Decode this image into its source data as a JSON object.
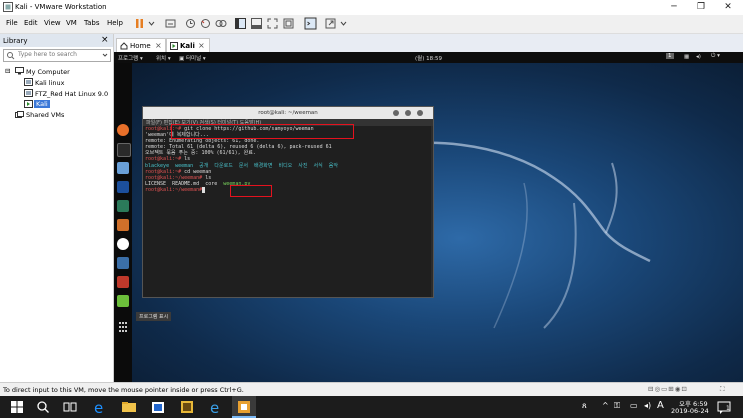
{
  "window": {
    "title": "Kali - VMware Workstation",
    "controls": {
      "minimize": "─",
      "restore": "❐",
      "close": "✕"
    }
  },
  "menubar": {
    "items": [
      "File",
      "Edit",
      "View",
      "VM",
      "Tabs",
      "Help"
    ]
  },
  "library": {
    "header": "Library",
    "close": "×",
    "search_placeholder": "Type here to search",
    "tree": {
      "root": "My Computer",
      "items": [
        "Kali linux",
        "FTZ_Red Hat Linux 9.0",
        "Kali"
      ],
      "shared": "Shared VMs"
    }
  },
  "tabs": [
    {
      "label": "Home"
    },
    {
      "label": "Kali"
    }
  ],
  "guest": {
    "topbar": {
      "left": [
        "프로그램 ▾",
        "위치 ▾",
        "▣ 터미널 ▾"
      ],
      "clock": "(월) 18:59",
      "right": "1"
    },
    "terminal": {
      "title": "root@kali: ~/weeman",
      "menu": "파일(F)  편집(E)  보기(V)  검색(S)  터미널(T)  도움말(H)",
      "lines": [
        {
          "prompt": "root@kali:~#",
          "cmd": " git clone https://github.com/samyoyo/weeman"
        },
        {
          "text": "'weeman'에 복제합니다..."
        },
        {
          "text": "remote: Enumerating objects: 61, done."
        },
        {
          "text": "remote: Total 61 (delta 6), reused 6 (delta 6), pack-reused 61"
        },
        {
          "text": "오브젝트 묶음 푸는 중: 100% (61/61), 완료."
        },
        {
          "prompt": "root@kali:~#",
          "cmd": " ls"
        },
        {
          "ls1": "blackeye  weeman  공개  다운로드  문서  배경화면  비디오  사진  서식  음악"
        },
        {
          "prompt": "root@kali:~#",
          "cmd": " cd weeman"
        },
        {
          "prompt": "root@kali:~/weeman#",
          "cmd": " ls"
        },
        {
          "ls2a": "LICENSE  README.md  core  ",
          "ls2b": "weeman.py"
        },
        {
          "prompt": "root@kali:~/weeman#",
          "cmd": ""
        }
      ]
    },
    "apps_tooltip": "프로그램 표시"
  },
  "statusbar": {
    "text": "To direct input to this VM, move the mouse pointer inside or press Ctrl+G."
  },
  "taskbar": {
    "tray_text": "A",
    "time": "오후 6:59",
    "date": "2019-06-24",
    "notif_count": "1"
  },
  "colors": {
    "accent": "#e5121e",
    "prompt": "#e05252",
    "dir": "#58a6ff",
    "exec": "#79d35c"
  }
}
